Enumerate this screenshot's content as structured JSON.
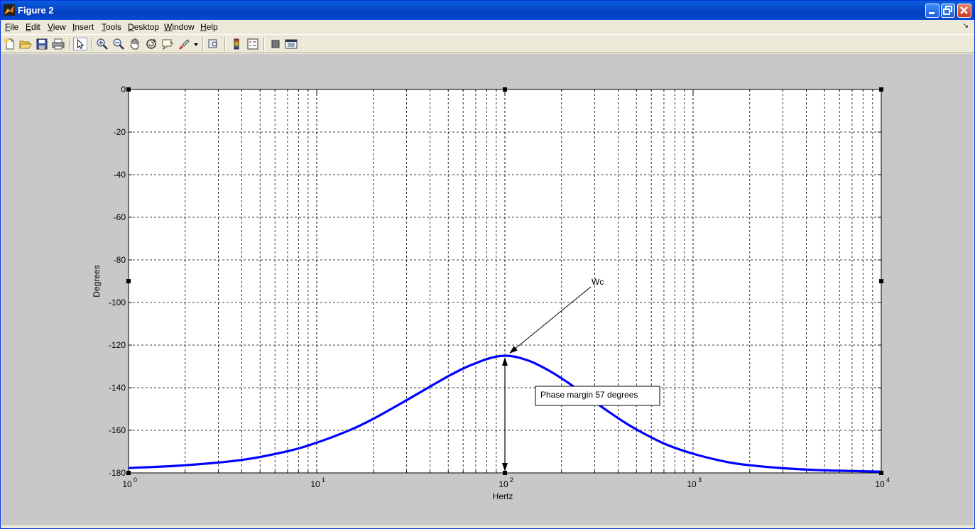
{
  "window": {
    "title": "Figure 2"
  },
  "menu": {
    "file": "File",
    "edit": "Edit",
    "view": "View",
    "insert": "Insert",
    "tools": "Tools",
    "desktop": "Desktop",
    "window": "Window",
    "help": "Help"
  },
  "toolbar": {
    "icons": [
      "new-figure-icon",
      "open-file-icon",
      "save-icon",
      "print-icon",
      "edit-plot-icon",
      "zoom-in-icon",
      "zoom-out-icon",
      "pan-icon",
      "rotate-3d-icon",
      "data-cursor-icon",
      "brush-icon",
      "link-plot-icon",
      "colorbar-icon",
      "legend-icon",
      "hide-plot-tools-icon",
      "show-plot-tools-icon"
    ]
  },
  "chart_data": {
    "type": "line",
    "title": "",
    "xlabel": "Hertz",
    "ylabel": "Degrees",
    "xscale": "log",
    "xlim": [
      1,
      10000
    ],
    "ylim": [
      -180,
      0
    ],
    "grid": true,
    "xtick_labels": [
      {
        "base": "10",
        "exp": "0"
      },
      {
        "base": "10",
        "exp": "1"
      },
      {
        "base": "10",
        "exp": "2"
      },
      {
        "base": "10",
        "exp": "3"
      },
      {
        "base": "10",
        "exp": "4"
      }
    ],
    "ytick_labels": [
      "0",
      "-20",
      "-40",
      "-60",
      "-80",
      "-100",
      "-120",
      "-140",
      "-160",
      "-180"
    ],
    "yticks": [
      0,
      -20,
      -40,
      -60,
      -80,
      -100,
      -120,
      -140,
      -160,
      -180
    ],
    "series": [
      {
        "color": "#0000FF",
        "x": [
          1,
          2,
          4,
          7,
          10,
          15,
          20,
          30,
          40,
          50,
          60,
          70,
          80,
          90,
          100,
          110,
          120,
          140,
          170,
          200,
          250,
          300,
          400,
          500,
          700,
          1000,
          1500,
          2000,
          3000,
          5000,
          10000
        ],
        "y": [
          -177.7,
          -176.4,
          -173.9,
          -169.8,
          -165.8,
          -159.9,
          -154.6,
          -145.9,
          -139.5,
          -134.6,
          -131.0,
          -128.5,
          -126.6,
          -125.4,
          -125.0,
          -125.3,
          -126.0,
          -128.0,
          -131.8,
          -135.6,
          -141.5,
          -146.7,
          -154.3,
          -159.6,
          -166.2,
          -171.0,
          -174.8,
          -176.4,
          -177.8,
          -178.8,
          -179.4
        ]
      }
    ],
    "annotations": [
      {
        "type": "arrow",
        "text": "Wc",
        "x": 100,
        "y": -125
      },
      {
        "type": "textbox",
        "text": "Phase margin 57 degrees"
      }
    ],
    "phase_margin_marker": {
      "x": 100,
      "y_from": -180,
      "y_to": -125
    }
  },
  "colors": {
    "line": "#0000FF",
    "figure_bg": "#C8C8C8",
    "axes_bg": "#FFFFFF"
  }
}
